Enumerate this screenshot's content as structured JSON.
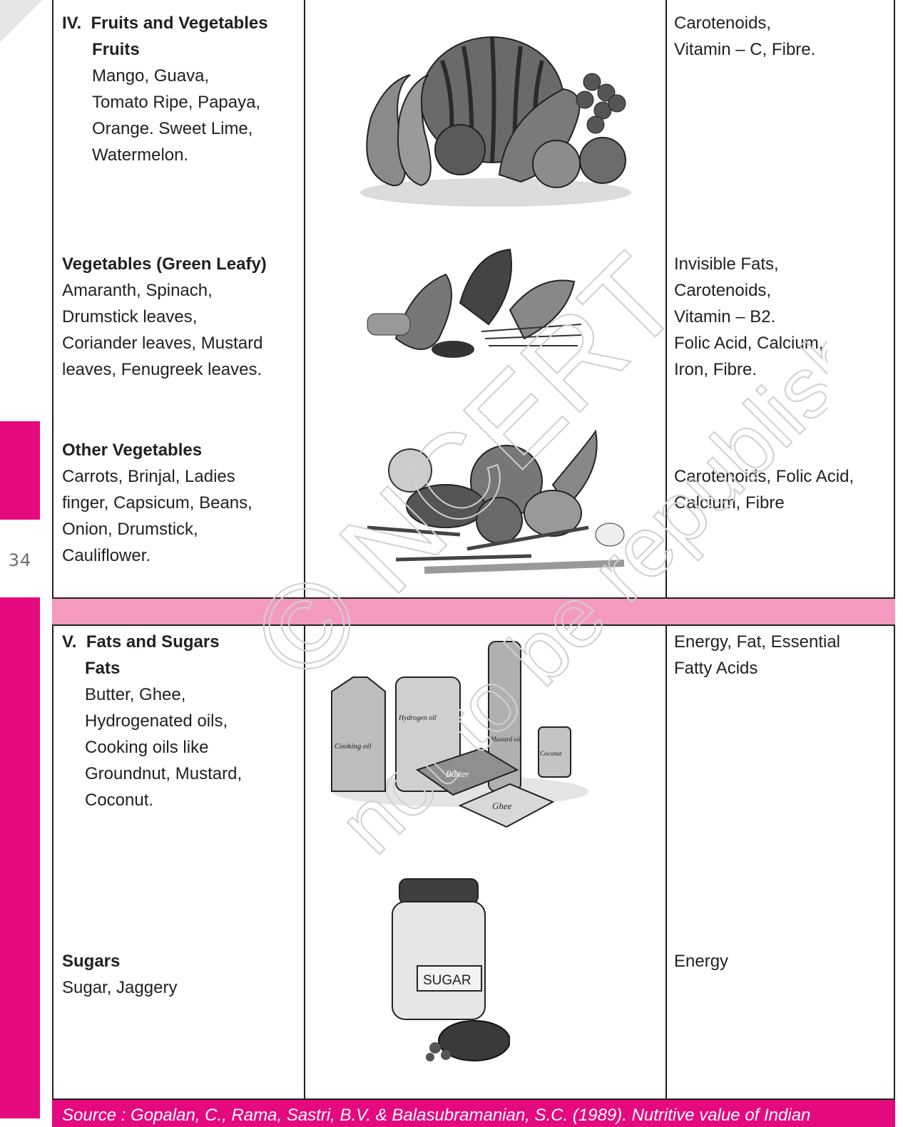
{
  "page_number": "34",
  "rows": {
    "fruits_veg": {
      "heading_numeral": "IV.",
      "heading": "Fruits and Vegetables",
      "sub_heading": "Fruits",
      "items": [
        "Mango, Guava,",
        "Tomato Ripe, Papaya,",
        "Orange. Sweet Lime,",
        "Watermelon."
      ],
      "nutrients": [
        "Carotenoids,",
        "Vitamin – C, Fibre."
      ]
    },
    "green_leafy": {
      "heading": "Vegetables (Green Leafy)",
      "items": [
        "Amaranth, Spinach,",
        "Drumstick leaves,",
        "Coriander leaves, Mustard",
        "leaves, Fenugreek leaves."
      ],
      "nutrients": [
        "Invisible Fats,",
        "Carotenoids,",
        "Vitamin – B2.",
        "Folic Acid, Calcium,",
        "Iron, Fibre."
      ]
    },
    "other_veg": {
      "heading": "Other Vegetables",
      "items": [
        "Carrots, Brinjal, Ladies",
        "finger, Capsicum, Beans,",
        "Onion, Drumstick,",
        "Cauliflower."
      ],
      "nutrients": [
        "Carotenoids, Folic Acid,",
        "Calcium, Fibre"
      ]
    },
    "fats": {
      "heading_numeral": "V.",
      "heading": "Fats and Sugars",
      "sub_heading": "Fats",
      "items": [
        "Butter, Ghee,",
        "Hydrogenated oils,",
        "Cooking oils like",
        "Groundnut, Mustard,",
        "Coconut."
      ],
      "nutrients": [
        "Energy, Fat, Essential",
        "Fatty Acids"
      ],
      "labels": {
        "cooking_oil": "Cooking oil",
        "hydrogenated": "Hydrogen oil",
        "mustard": "Mustard oil",
        "coconut": "Coconut",
        "butter": "Butter",
        "ghee": "Ghee"
      }
    },
    "sugars": {
      "heading": "Sugars",
      "items": [
        "Sugar, Jaggery"
      ],
      "nutrients": [
        "Energy"
      ],
      "jar_label": "SUGAR"
    }
  },
  "source": "Source : Gopalan, C., Rama, Sastri, B.V. & Balasubramanian, S.C. (1989). Nutritive value of Indian",
  "watermark": {
    "line1": "© NCERT",
    "line2": "not to be republished"
  }
}
